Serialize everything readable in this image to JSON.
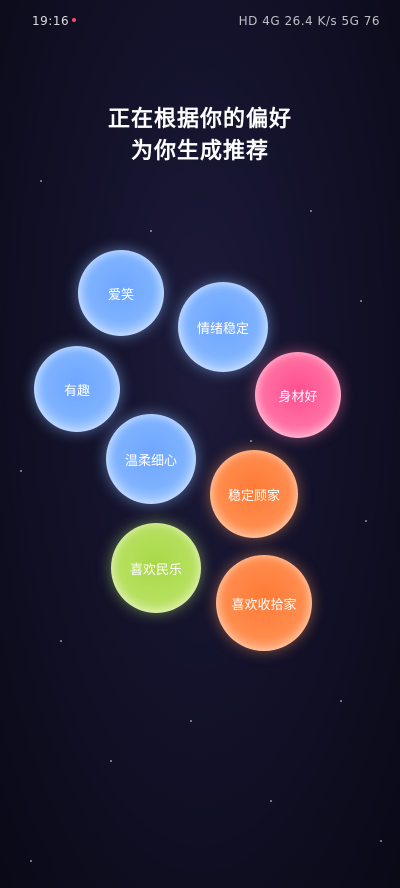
{
  "status_bar": {
    "time": "19:16",
    "right_text": "HD 4G 26.4 K/s 5G 76"
  },
  "headline": {
    "line1": "正在根据你的偏好",
    "line2": "为你生成推荐"
  },
  "bubbles": [
    {
      "label": "爱笑",
      "color": "blue"
    },
    {
      "label": "情绪稳定",
      "color": "blue"
    },
    {
      "label": "有趣",
      "color": "blue"
    },
    {
      "label": "身材好",
      "color": "pink"
    },
    {
      "label": "温柔细心",
      "color": "blue"
    },
    {
      "label": "稳定顾家",
      "color": "orange"
    },
    {
      "label": "喜欢民乐",
      "color": "green"
    },
    {
      "label": "喜欢收拾家",
      "color": "orange"
    }
  ],
  "colors": {
    "background": "#13122a",
    "blue": "#7eb2ff",
    "pink": "#ff6fa2",
    "orange": "#ff8c4d",
    "green": "#b6e05e"
  }
}
